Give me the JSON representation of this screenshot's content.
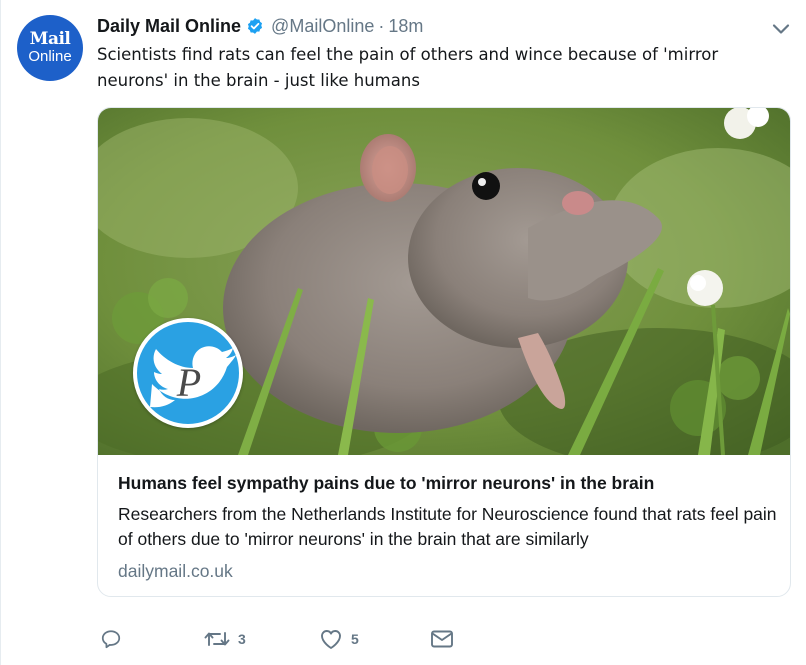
{
  "tweet": {
    "avatar": {
      "line1": "Mail",
      "line2": "Online",
      "color": "#1d60c9"
    },
    "display_name": "Daily Mail Online",
    "verified": true,
    "handle": "@MailOnline",
    "separator": "·",
    "time": "18m",
    "text": "Scientists find rats can feel the pain of others and wince because of 'mirror neurons' in the brain - just like humans"
  },
  "card": {
    "image_icon": "rat-photo",
    "badge_icon": "twitter-bird-p-badge",
    "title": "Humans feel sympathy pains due to 'mirror neurons' in the brain",
    "description": "Researchers from the Netherlands Institute for Neuroscience found that rats feel pain of others due to 'mirror neurons' in the brain that are similarly",
    "domain": "dailymail.co.uk"
  },
  "actions": {
    "reply": {
      "icon": "reply-icon",
      "count": ""
    },
    "retweet": {
      "icon": "retweet-icon",
      "count": "3"
    },
    "like": {
      "icon": "heart-icon",
      "count": "5"
    },
    "message": {
      "icon": "envelope-icon",
      "count": ""
    }
  },
  "colors": {
    "text": "#14171a",
    "muted": "#657786",
    "verified": "#1da1f2",
    "badge": "#2aa1e3"
  }
}
